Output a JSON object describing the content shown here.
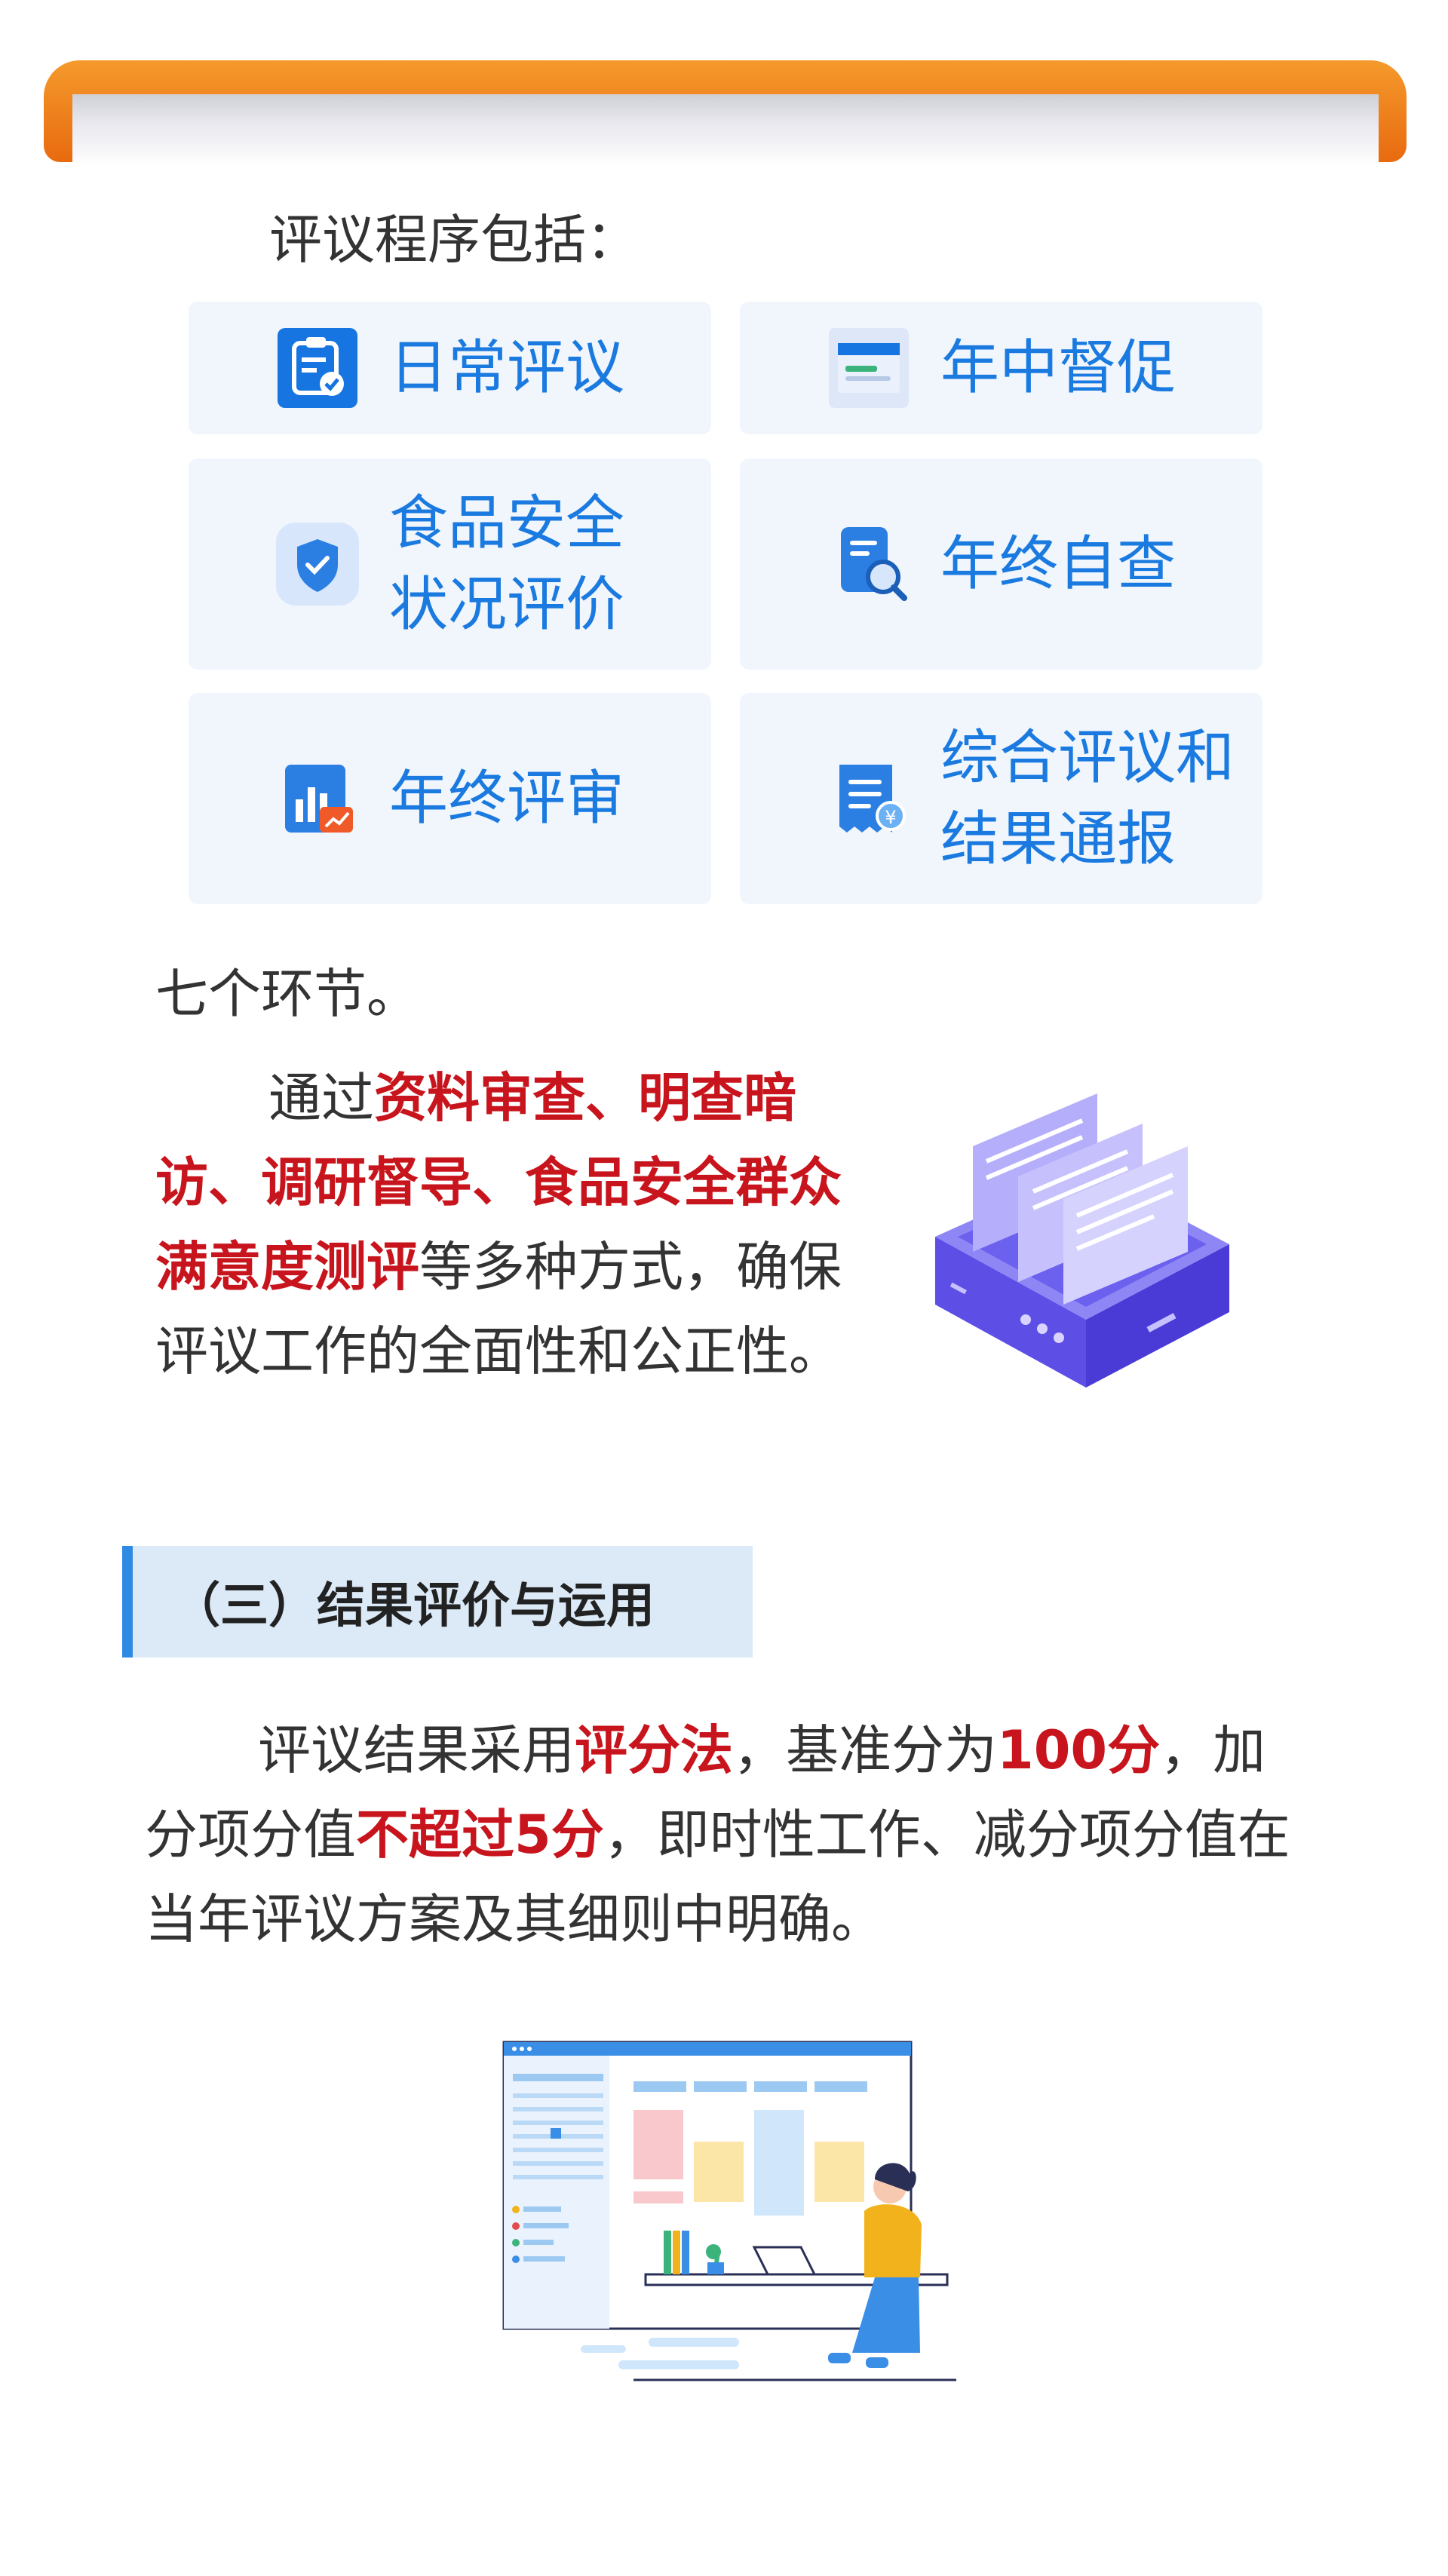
{
  "banner": {
    "color": "#ef7f1c"
  },
  "intro": {
    "text": "评议程序包括："
  },
  "steps": [
    {
      "label": "日常评议",
      "icon": "clipboard-icon"
    },
    {
      "label": "年中督促",
      "icon": "calendar-card-icon"
    },
    {
      "label": "食品安全\n状况评价",
      "icon": "shield-check-icon"
    },
    {
      "label": "年终自查",
      "icon": "document-search-icon"
    },
    {
      "label": "年终评审",
      "icon": "chart-report-icon"
    },
    {
      "label": "综合评议和\n结果通报",
      "icon": "receipt-yen-icon"
    }
  ],
  "seven": {
    "text": "七个环节。"
  },
  "paragraph1": {
    "lead": "通过",
    "highlight": "资料审查、明查暗访、调研督导、食品安全群众满意度测评",
    "tail": "等多种方式，确保评议工作的全面性和公正性。"
  },
  "section": {
    "title": "（三）结果评价与运用"
  },
  "paragraph2": {
    "p1": "评议结果采用",
    "h1": "评分法",
    "p2": "，基准分为",
    "h2": "100分",
    "p3": "，加分项分值",
    "h3": "不超过5分",
    "p4": "，即时性工作、减分项分值在当年评议方案及其细则中明确。"
  },
  "colors": {
    "accent": "#1a7ae0",
    "highlight": "#c8141c",
    "card_bg": "#f1f6fd",
    "section_bg": "#dceaf8"
  }
}
